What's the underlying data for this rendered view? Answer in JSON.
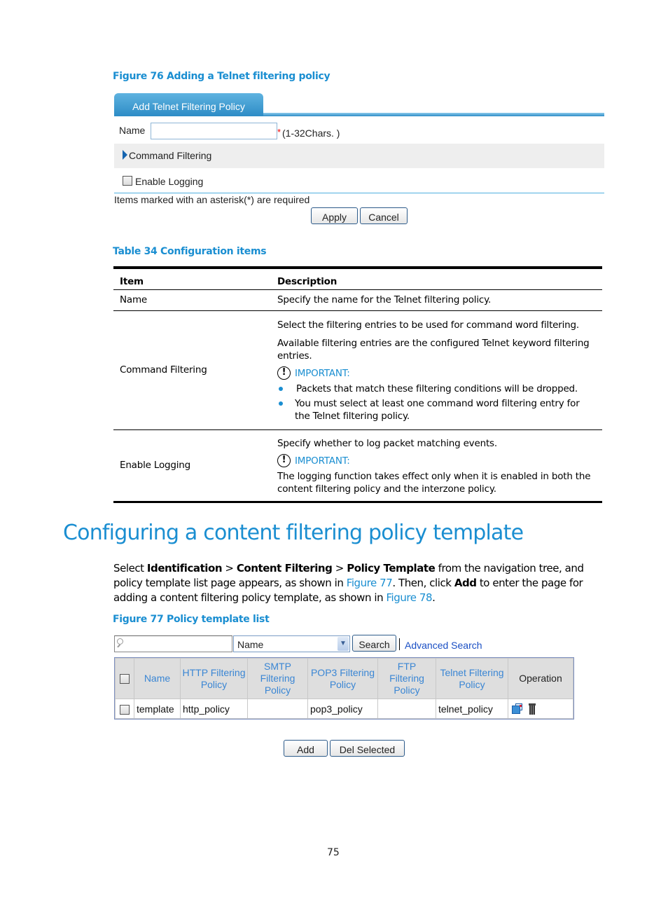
{
  "figure76": {
    "caption": "Figure 76 Adding a Telnet filtering policy",
    "tab_label": "Add Telnet Filtering Policy",
    "name_label": "Name",
    "name_value": "",
    "required_star": "*",
    "name_hint": "(1-32Chars. )",
    "command_filtering_label": "Command Filtering",
    "enable_logging_label": "Enable Logging",
    "enable_logging_checked": false,
    "required_note": "Items marked with an asterisk(*) are required",
    "apply_label": "Apply",
    "cancel_label": "Cancel"
  },
  "table34": {
    "caption": "Table 34 Configuration items",
    "headers": [
      "Item",
      "Description"
    ],
    "rows": [
      {
        "item": "Name",
        "desc": [
          "Specify the name for the Telnet filtering policy."
        ]
      },
      {
        "item": "Command Filtering",
        "desc": [
          "Select the filtering entries to be used for command word filtering.",
          "Available filtering entries are the configured Telnet keyword filtering entries."
        ],
        "important_label": "IMPORTANT:",
        "bullets": [
          "Packets that match these filtering conditions will be dropped.",
          "You must select at least one command word filtering entry for the Telnet filtering policy."
        ]
      },
      {
        "item": "Enable Logging",
        "desc": [
          "Specify whether to log packet matching events."
        ],
        "important_label": "IMPORTANT:",
        "note": "The logging function takes effect only when it is enabled in both the content filtering policy and the interzone policy."
      }
    ]
  },
  "section": {
    "title": "Configuring a content filtering policy template",
    "para": {
      "t1": "Select ",
      "b1": "Identification",
      "t2": " > ",
      "b2": "Content Filtering",
      "t3": " > ",
      "b3": "Policy Template",
      "t4": " from the navigation tree, and policy template list page appears, as shown in ",
      "link1": "Figure 77",
      "t5": ". Then, click ",
      "b4": "Add",
      "t6": " to enter the page for adding a content filtering policy template, as shown in ",
      "link2": "Figure 78",
      "t7": "."
    }
  },
  "figure77": {
    "caption": "Figure 77 Policy template list",
    "search_value": "",
    "search_field_selected": "Name",
    "search_label": "Search",
    "advanced_search_label": "Advanced Search",
    "columns": [
      "Name",
      "HTTP Filtering Policy",
      "SMTP Filtering Policy",
      "POP3 Filtering Policy",
      "FTP Filtering Policy",
      "Telnet Filtering Policy",
      "Operation"
    ],
    "rows": [
      {
        "name": "template",
        "http": "http_policy",
        "smtp": "",
        "pop3": "pop3_policy",
        "ftp": "",
        "telnet": "telnet_policy"
      }
    ],
    "add_label": "Add",
    "del_selected_label": "Del Selected"
  },
  "page_number": "75"
}
